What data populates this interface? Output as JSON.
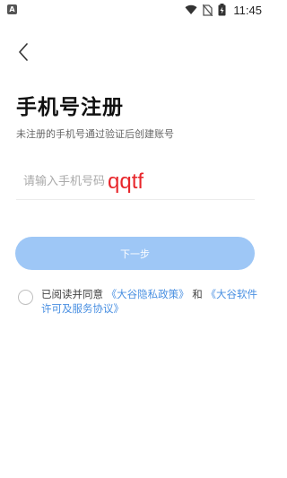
{
  "status_bar": {
    "notification_icon": "a-icon",
    "time": "11:45"
  },
  "page": {
    "title": "手机号注册",
    "subtitle": "未注册的手机号通过验证后创建账号"
  },
  "phone_input": {
    "placeholder": "请输入手机号码",
    "value": ""
  },
  "overlay": {
    "text": "qqtf"
  },
  "next_button": {
    "label": "下一步"
  },
  "agreement": {
    "prefix": "已阅读并同意 ",
    "privacy_link": "《大谷隐私政策》",
    "connector": " 和 ",
    "license_link": "《大谷软件许可及服务协议》"
  },
  "colors": {
    "accent": "#9ec7f6",
    "link": "#4a90e2",
    "overlay_text": "#e8262b"
  }
}
